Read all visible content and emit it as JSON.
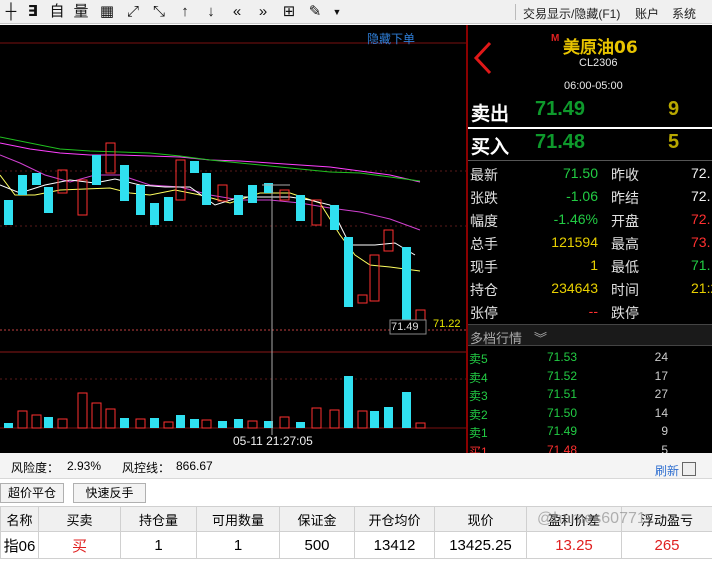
{
  "toolbar": {
    "icons": [
      "cross-line-icon",
      "exit-icon",
      "custom-indicator-icon",
      "volume-icon",
      "window-icon",
      "zoom-in-icon",
      "zoom-out-icon",
      "arrow-up-icon",
      "arrow-down-icon",
      "page-left-icon",
      "page-right-icon",
      "grid-layout-icon",
      "draw-pen-icon",
      "dropdown-arrow-icon"
    ],
    "labels": {
      "zi": "自",
      "liang": "量"
    },
    "menu": [
      "交易显示/隐藏(F1)",
      "账户",
      "系统"
    ]
  },
  "chart": {
    "hide_order_label": "隐藏下单",
    "price_tag": "71.49",
    "price_tag_right": "71.22",
    "crosshair_time": "05-11 21:27:05"
  },
  "quote": {
    "marker": "M",
    "name": "美原油06",
    "code": "CL2306",
    "session": "06:00-05:00",
    "ask": {
      "label": "卖出",
      "price": "71.49",
      "qty": "9"
    },
    "bid": {
      "label": "买入",
      "price": "71.48",
      "qty": "5"
    },
    "rows": [
      {
        "l1": "最新",
        "v1": "71.50",
        "c1": "green",
        "l2": "昨收",
        "v2": "72.",
        "c2": "white"
      },
      {
        "l1": "张跌",
        "v1": "-1.06",
        "c1": "green",
        "l2": "昨结",
        "v2": "72.",
        "c2": "white"
      },
      {
        "l1": "幅度",
        "v1": "-1.46%",
        "c1": "green",
        "l2": "开盘",
        "v2": "72.",
        "c2": "red"
      },
      {
        "l1": "总手",
        "v1": "121594",
        "c1": "yellow",
        "l2": "最高",
        "v2": "73.",
        "c2": "red"
      },
      {
        "l1": "现手",
        "v1": "1",
        "c1": "yellow",
        "l2": "最低",
        "v2": "71.",
        "c2": "green"
      },
      {
        "l1": "持仓",
        "v1": "234643",
        "c1": "yellow",
        "l2": "时间",
        "v2": "21:28:",
        "c2": "yellow"
      },
      {
        "l1": "张停",
        "v1": "--",
        "c1": "red",
        "l2": "跌停",
        "v2": "",
        "c2": "green"
      }
    ],
    "depth_header": "多档行情",
    "depth": [
      {
        "label": "卖5",
        "price": "71.53",
        "qty": "24"
      },
      {
        "label": "卖4",
        "price": "71.52",
        "qty": "17"
      },
      {
        "label": "卖3",
        "price": "71.51",
        "qty": "27"
      },
      {
        "label": "卖2",
        "price": "71.50",
        "qty": "14"
      },
      {
        "label": "卖1",
        "price": "71.49",
        "qty": "9"
      },
      {
        "label": "买1",
        "price": "71.48",
        "qty": "5"
      }
    ]
  },
  "risk": {
    "risk_label": "风险度：",
    "risk_value": "2.93%",
    "control_label": "风控线：",
    "control_value": "866.67",
    "refresh": "刷新"
  },
  "actions": [
    "超价平仓",
    "快速反手"
  ],
  "positions": {
    "headers": [
      "名称",
      "买卖",
      "持仓量",
      "可用数量",
      "保证金",
      "开仓均价",
      "现价",
      "盈利价差",
      "浮动盈亏"
    ],
    "rows": [
      [
        "指06",
        "买",
        "1",
        "1",
        "500",
        "13412",
        "13425.25",
        "13.25",
        "265"
      ]
    ]
  },
  "watermark": "@hames60771"
}
